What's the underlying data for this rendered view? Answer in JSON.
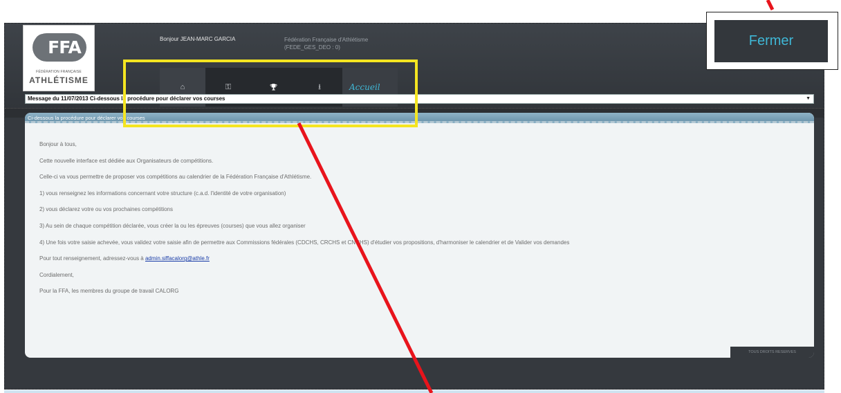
{
  "logo": {
    "letters": "FFA",
    "sub": "FÉDÉRATION FRANÇAISE",
    "main": "ATHLÉTISME"
  },
  "header": {
    "greeting": "Bonjour JEAN-MARC GARCIA",
    "federation_line1": "Fédération Française d'Athlétisme",
    "federation_line2": "(FEDE_GES_DEO : 0)"
  },
  "nav": {
    "items": [
      {
        "icon": "home-icon",
        "glyph": "⌂"
      },
      {
        "icon": "key-icon",
        "glyph": "⚿"
      },
      {
        "icon": "trophy-icon",
        "glyph": "🏆"
      },
      {
        "icon": "download-icon",
        "glyph": "⭳"
      }
    ],
    "current_label": "Accueil"
  },
  "message_select": {
    "value": "Message du 11/07/2013 Ci-dessous la procédure pour déclarer vos courses"
  },
  "panel": {
    "title": "Ci-dessous la procédure pour déclarer vos courses",
    "paragraphs": [
      "Bonjour à tous,",
      "Cette nouvelle interface est dédiée aux Organisateurs de compétitions.",
      "Celle-ci va vous permettre de proposer vos compétitions au calendrier de la Fédération Française d'Athlétisme.",
      "1) vous renseignez les informations concernant votre structure (c.a.d. l'identité de votre organisation)",
      "2) vous déclarez votre ou vos prochaines compétitions",
      "3) Au sein de chaque compétition déclarée, vous créer la ou les épreuves (courses) que vous allez organiser",
      "4) Une fois votre saisie achevée, vous validez votre saisie afin de permettre aux Commissions fédérales (CDCHS, CRCHS et CNCHS) d'étudier vos propositions, d'harmoniser le calendrier et de Valider vos demandes"
    ],
    "contact_prefix": "Pour tout renseignement, adressez-vous à ",
    "contact_email": "admin.siffacalorg@athle.fr",
    "closing": "Cordialement,",
    "signature": "Pour la FFA, les membres du groupe de travail CALORG",
    "footer": "TOUS DROITS RESERVES"
  },
  "fermer_label": "Fermer",
  "colors": {
    "accent": "#3fb7d6",
    "highlight": "#f4e521",
    "arrow": "#e8141c"
  }
}
